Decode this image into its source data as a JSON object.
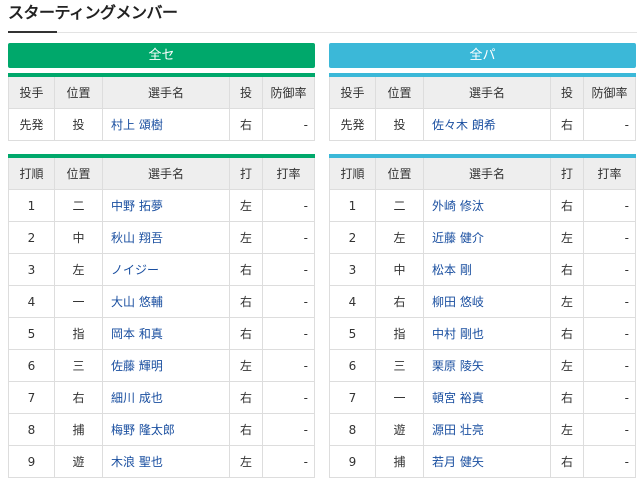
{
  "header": {
    "title": "スターティングメンバー"
  },
  "colors": {
    "central": "#00a86b",
    "pacific": "#3bb8d8",
    "link": "#1a4fa0"
  },
  "central": {
    "team_label": "全セ",
    "pitcher_headers": [
      "投手",
      "位置",
      "選手名",
      "投",
      "防御率"
    ],
    "pitcher": {
      "role": "先発",
      "pos": "投",
      "name": "村上 頌樹",
      "throws": "右",
      "era": "-"
    },
    "lineup_headers": [
      "打順",
      "位置",
      "選手名",
      "打",
      "打率"
    ],
    "lineup": [
      {
        "order": "1",
        "pos": "二",
        "name": "中野 拓夢",
        "bats": "左",
        "avg": "-"
      },
      {
        "order": "2",
        "pos": "中",
        "name": "秋山 翔吾",
        "bats": "左",
        "avg": "-"
      },
      {
        "order": "3",
        "pos": "左",
        "name": "ノイジー",
        "bats": "右",
        "avg": "-"
      },
      {
        "order": "4",
        "pos": "一",
        "name": "大山 悠輔",
        "bats": "右",
        "avg": "-"
      },
      {
        "order": "5",
        "pos": "指",
        "name": "岡本 和真",
        "bats": "右",
        "avg": "-"
      },
      {
        "order": "6",
        "pos": "三",
        "name": "佐藤 輝明",
        "bats": "左",
        "avg": "-"
      },
      {
        "order": "7",
        "pos": "右",
        "name": "細川 成也",
        "bats": "右",
        "avg": "-"
      },
      {
        "order": "8",
        "pos": "捕",
        "name": "梅野 隆太郎",
        "bats": "右",
        "avg": "-"
      },
      {
        "order": "9",
        "pos": "遊",
        "name": "木浪 聖也",
        "bats": "左",
        "avg": "-"
      }
    ]
  },
  "pacific": {
    "team_label": "全パ",
    "pitcher_headers": [
      "投手",
      "位置",
      "選手名",
      "投",
      "防御率"
    ],
    "pitcher": {
      "role": "先発",
      "pos": "投",
      "name": "佐々木 朗希",
      "throws": "右",
      "era": "-"
    },
    "lineup_headers": [
      "打順",
      "位置",
      "選手名",
      "打",
      "打率"
    ],
    "lineup": [
      {
        "order": "1",
        "pos": "二",
        "name": "外崎 修汰",
        "bats": "右",
        "avg": "-"
      },
      {
        "order": "2",
        "pos": "左",
        "name": "近藤 健介",
        "bats": "左",
        "avg": "-"
      },
      {
        "order": "3",
        "pos": "中",
        "name": "松本 剛",
        "bats": "右",
        "avg": "-"
      },
      {
        "order": "4",
        "pos": "右",
        "name": "柳田 悠岐",
        "bats": "左",
        "avg": "-"
      },
      {
        "order": "5",
        "pos": "指",
        "name": "中村 剛也",
        "bats": "右",
        "avg": "-"
      },
      {
        "order": "6",
        "pos": "三",
        "name": "栗原 陵矢",
        "bats": "左",
        "avg": "-"
      },
      {
        "order": "7",
        "pos": "一",
        "name": "頓宮 裕真",
        "bats": "右",
        "avg": "-"
      },
      {
        "order": "8",
        "pos": "遊",
        "name": "源田 壮亮",
        "bats": "左",
        "avg": "-"
      },
      {
        "order": "9",
        "pos": "捕",
        "name": "若月 健矢",
        "bats": "右",
        "avg": "-"
      }
    ]
  }
}
